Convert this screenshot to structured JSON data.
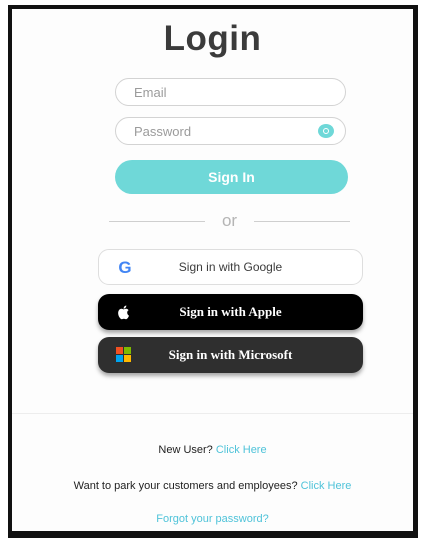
{
  "login": {
    "title": "Login",
    "email_placeholder": "Email",
    "password_placeholder": "Password",
    "signin_label": "Sign In",
    "or_label": "or"
  },
  "social": {
    "google_label": "Sign in with Google",
    "apple_label": "Sign in with Apple",
    "microsoft_label": "Sign in with Microsoft",
    "google_icon": "google-g-icon",
    "apple_icon": "apple-logo-icon",
    "microsoft_icon": "microsoft-logo-icon"
  },
  "footer": {
    "new_user_text": "New User?",
    "new_user_link": "Click Here",
    "park_text": "Want to park your customers and employees?",
    "park_link": "Click Here",
    "forgot_link": "Forgot your password?"
  },
  "colors": {
    "accent": "#6fd8d8",
    "link": "#4fc3d9",
    "title": "#3b3b3b",
    "apple_button": "#000000",
    "microsoft_button": "#2f2f2f"
  }
}
